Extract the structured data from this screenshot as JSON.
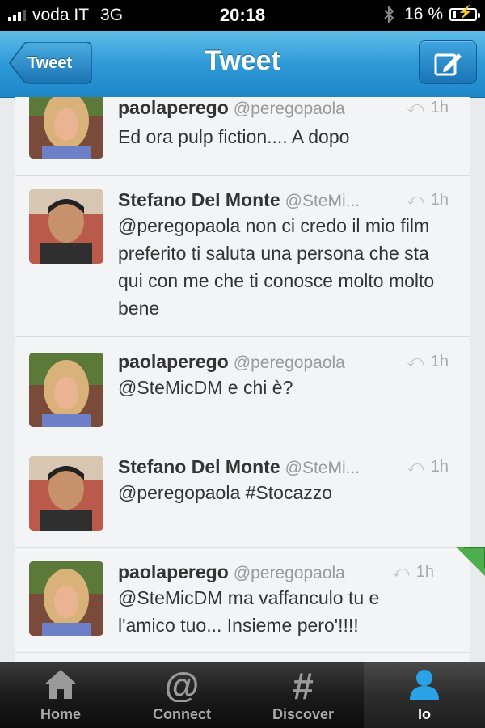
{
  "status_bar": {
    "carrier": "voda IT",
    "network": "3G",
    "time": "20:18",
    "battery": "16 %",
    "battery_level": 0.16
  },
  "nav": {
    "back_label": "Tweet",
    "title": "Tweet",
    "compose_icon": "compose-icon"
  },
  "tweets": [
    {
      "name": "paolaperego",
      "handle": "@peregopaola",
      "time": "1h",
      "text": "Ed ora pulp fiction.... A dopo"
    },
    {
      "name": "Stefano Del Monte",
      "handle": "@SteMi...",
      "time": "1h",
      "text": "@peregopaola non ci credo il mio film preferito ti saluta una persona che sta qui con me che ti conosce molto molto bene"
    },
    {
      "name": "paolaperego",
      "handle": "@peregopaola",
      "time": "1h",
      "text": "@SteMicDM e chi è?"
    },
    {
      "name": "Stefano Del Monte",
      "handle": "@SteMi...",
      "time": "1h",
      "text": "@peregopaola #Stocazzo"
    },
    {
      "name": "paolaperego",
      "handle": "@peregopaola",
      "time": "1h",
      "text": "@SteMicDM ma vaffanculo tu e l'amico tuo... Insieme pero'!!!!"
    }
  ],
  "tabs": [
    {
      "label": "Home",
      "icon": "home-icon"
    },
    {
      "label": "Connect",
      "icon": "at-icon"
    },
    {
      "label": "Discover",
      "icon": "hash-icon"
    },
    {
      "label": "Io",
      "icon": "person-icon",
      "active": true
    }
  ],
  "colors": {
    "nav_blue": "#2f9ad8",
    "text": "#333333",
    "handle_gray": "#9a9a9a",
    "tab_bar": "#1c1c1c",
    "active_tab_icon": "#29a3e6"
  }
}
